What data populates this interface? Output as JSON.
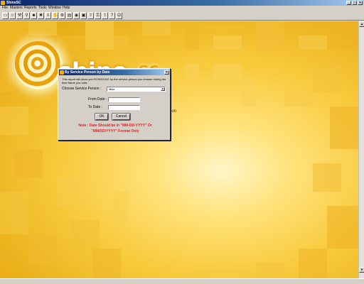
{
  "window": {
    "title": "ShineSC",
    "controls": {
      "minimize": "_",
      "maximize": "□",
      "close": "×"
    }
  },
  "menu": {
    "items": [
      "File",
      "Masters",
      "Reports",
      "Tools",
      "Window",
      "Help"
    ]
  },
  "toolbar": {
    "buttons": [
      {
        "icon": "open-icon",
        "glyph": "▭"
      },
      {
        "icon": "person-icon",
        "glyph": "☺"
      },
      {
        "icon": "tools-icon",
        "glyph": "⚒"
      },
      {
        "icon": "pin-icon",
        "glyph": "⚲"
      },
      {
        "icon": "group-icon",
        "glyph": "☻"
      },
      {
        "icon": "delete-icon",
        "glyph": "✖"
      },
      {
        "icon": "list-icon",
        "glyph": "≡"
      },
      {
        "icon": "handshake-icon",
        "glyph": "✋"
      },
      {
        "icon": "settings-icon",
        "glyph": "⚙"
      },
      {
        "icon": "document-icon",
        "glyph": "▤"
      },
      {
        "icon": "globe-icon",
        "glyph": "◉"
      },
      {
        "icon": "lock-icon",
        "glyph": "▣"
      },
      {
        "icon": "upload-icon",
        "glyph": "⇧"
      },
      {
        "icon": "key-icon",
        "glyph": "⚿"
      },
      {
        "icon": "export-icon",
        "glyph": "⇪"
      },
      {
        "icon": "help-icon",
        "glyph": "?"
      },
      {
        "icon": "user-icon",
        "glyph": "☹"
      }
    ]
  },
  "desktop": {
    "brand_text": "shine",
    "brand_accent": "sc",
    "brand_suffix": "ion"
  },
  "dialog": {
    "title": "By Service Person  by Date",
    "close_glyph": "×",
    "description": "This report will show you SCHEDULE by the service person you choose during the time frame you note.",
    "service_person_label": "Choose Service Person :",
    "service_person_value": "Mike",
    "from_date_label": "From Date :",
    "from_date_value": "",
    "to_date_label": "To Date :",
    "to_date_value": "",
    "ok_label": "OK",
    "cancel_label": "Cancel",
    "note_line1": "Note : Date Should be in \"MM-DD-YYYY\" Or",
    "note_line2": "\"MM/DD/YYYY\" Format Only",
    "note_color": "#e02020"
  },
  "colors": {
    "titlebar_start": "#0a246a",
    "titlebar_end": "#a6caf0",
    "desktop_main": "#f8cb3e",
    "chrome": "#d4d0c8"
  }
}
